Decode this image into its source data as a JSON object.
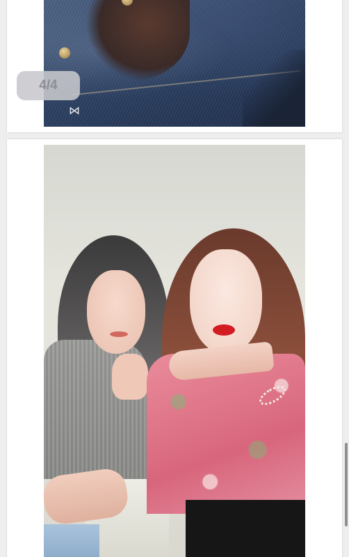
{
  "gallery": {
    "page_indicator": "4/4",
    "photos": [
      {
        "icon": "denim-jacket-photo"
      },
      {
        "icon": "two-women-selfie-photo"
      }
    ]
  },
  "colors": {
    "page_background": "#eeeeee",
    "card_background": "#ffffff",
    "badge_background": "#c8c8cd",
    "badge_text": "#8d8d94"
  }
}
